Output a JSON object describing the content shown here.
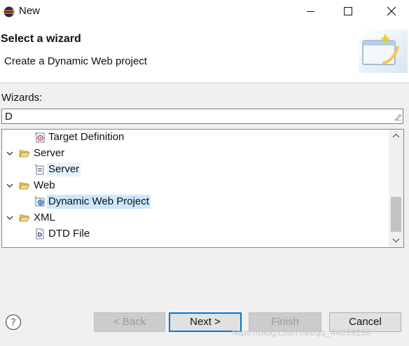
{
  "window": {
    "title": "New",
    "app_icon": "eclipse-icon",
    "controls": {
      "minimize_icon": "minimize-icon",
      "maximize_icon": "maximize-icon",
      "close_icon": "close-icon"
    }
  },
  "header": {
    "title": "Select a wizard",
    "description": "Create a Dynamic Web project",
    "banner_icon": "new-wizard-banner-icon"
  },
  "filter": {
    "label": "Wizards:",
    "value": "D",
    "clear_icon": "clear-filter-icon"
  },
  "tree": {
    "items": [
      {
        "label": "Target Definition",
        "icon": "target-definition-icon",
        "expanded": null,
        "selected": false
      },
      {
        "label": "Server",
        "icon": "folder-open-icon",
        "expanded": true,
        "selected": false
      },
      {
        "label": "Server",
        "icon": "server-wizard-icon",
        "expanded": null,
        "selected": false,
        "hover": true
      },
      {
        "label": "Web",
        "icon": "folder-open-icon",
        "expanded": true,
        "selected": false
      },
      {
        "label": "Dynamic Web Project",
        "icon": "web-project-icon",
        "expanded": null,
        "selected": true
      },
      {
        "label": "XML",
        "icon": "folder-open-icon",
        "expanded": true,
        "selected": false
      },
      {
        "label": "DTD File",
        "icon": "dtd-file-icon",
        "expanded": null,
        "selected": false
      }
    ]
  },
  "buttons": {
    "back": "< Back",
    "next": "Next >",
    "finish": "Finish",
    "cancel": "Cancel",
    "help_icon": "help-icon"
  },
  "watermark": "https://blog.csdn.net/qq_44839238",
  "colors": {
    "selection": "#cce8ff",
    "hover": "#e5f3ff",
    "default_button_border": "#0078d7",
    "dialog_background": "#f0f0f0"
  }
}
